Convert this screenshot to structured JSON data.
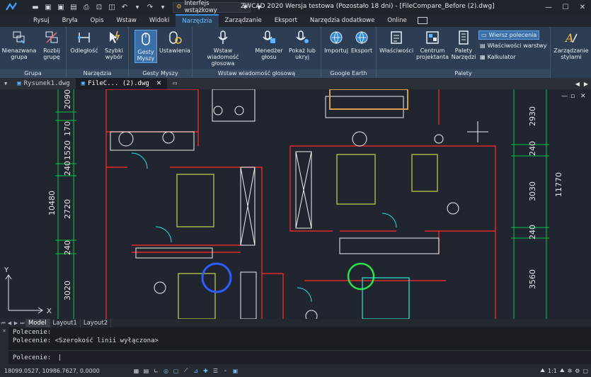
{
  "titlebar": {
    "workspace": "Interfejs wstążkowy",
    "title": "ZWCAD 2020 Wersja testowa (Pozostało 18 dni) - [FileCompare_Before (2).dwg]",
    "window_controls": [
      "minimize-icon",
      "maximize-icon",
      "close-icon"
    ]
  },
  "menu": {
    "tabs": [
      "Rysuj",
      "Bryła",
      "Opis",
      "Wstaw",
      "Widoki",
      "Narzędzia",
      "Zarządzanie",
      "Eksport",
      "Narzędzia dodatkowe",
      "Online"
    ],
    "active": "Narzędzia"
  },
  "ribbon": {
    "groups": {
      "grupa": {
        "label": "Grupa",
        "btn1": "Nienazwana",
        "btn1b": "grupa",
        "btn2": "Rozbij",
        "btn2b": "grupę"
      },
      "narzedzia": {
        "label": "Narzędzia",
        "btn1": "Odległość",
        "btn2": "Szybki",
        "btn2b": "wybór"
      },
      "gesty": {
        "label": "Gesty Myszy",
        "btn1": "Gesty",
        "btn1b": "Myszy",
        "btn2": "Ustawienia"
      },
      "voice": {
        "label": "Wstaw wiadomość głosową",
        "btn1": "Wstaw",
        "btn1b": "wiadomość głosowa",
        "btn2": "Menedżer",
        "btn2b": "głosu",
        "btn3": "Pokaż lub",
        "btn3b": "ukryj"
      },
      "earth": {
        "label": "Google Earth",
        "btn1": "Importuj",
        "btn2": "Eksport"
      },
      "palety": {
        "label": "Palety",
        "btn1": "Właściwości",
        "btn2": "Centrum",
        "btn2b": "projektanta",
        "btn3": "Palety",
        "btn3b": "Narzędzi",
        "small1": "Wiersz polecenia",
        "small2": "Właściwości warstwy",
        "small3": "Kalkulator"
      },
      "style": {
        "btn1": "Zarządzanie",
        "btn1b": "stylami"
      }
    }
  },
  "doctabs": [
    {
      "label": "Rysunek1.dwg"
    },
    {
      "label": "FileC... (2).dwg"
    }
  ],
  "dimensions": {
    "left": [
      "2090",
      "170",
      "1520",
      "240",
      "2720",
      "240",
      "3020"
    ],
    "left_total": "10480",
    "right": [
      "2930",
      "240",
      "3030",
      "240",
      "3560"
    ],
    "right_total": "11770"
  },
  "axis": {
    "x": "X",
    "y": "Y"
  },
  "layout_tabs": [
    "Model",
    "Layout1",
    "Layout2"
  ],
  "command": {
    "lines": [
      "Polecenie:",
      "Polecenie:  <Szerokość linii wyłączona>"
    ],
    "prompt": "Polecenie:"
  },
  "status": {
    "coords": "18099.0527, 10986.7627, 0.0000",
    "scale": "1:1"
  },
  "colors": {
    "canvas": "#202530",
    "walls": "#e02a2a",
    "furniture": "#f0f0f0",
    "dims": "#00c846",
    "accent": "#3d8de0"
  }
}
